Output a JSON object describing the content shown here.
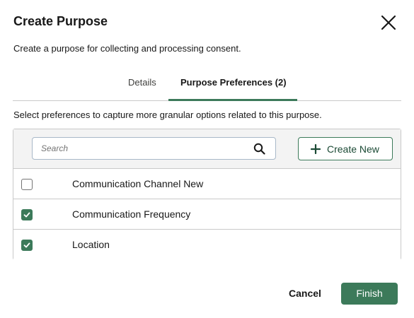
{
  "modal": {
    "title": "Create Purpose",
    "subtitle": "Create a purpose for collecting and processing consent.",
    "close_icon": "close-icon"
  },
  "tabs": [
    {
      "label": "Details",
      "active": false
    },
    {
      "label": "Purpose Preferences (2)",
      "active": true
    }
  ],
  "instructions": "Select preferences to capture more granular options related to this purpose.",
  "toolbar": {
    "search_placeholder": "Search",
    "search_icon": "search-icon",
    "create_new_label": "Create New",
    "create_new_icon": "plus-icon"
  },
  "preferences": [
    {
      "label": "Communication Channel New",
      "checked": false
    },
    {
      "label": "Communication Frequency",
      "checked": true
    },
    {
      "label": "Location",
      "checked": true
    }
  ],
  "footer": {
    "cancel_label": "Cancel",
    "finish_label": "Finish"
  },
  "colors": {
    "accent": "#3c7a5a",
    "border": "#c9c9c9"
  }
}
